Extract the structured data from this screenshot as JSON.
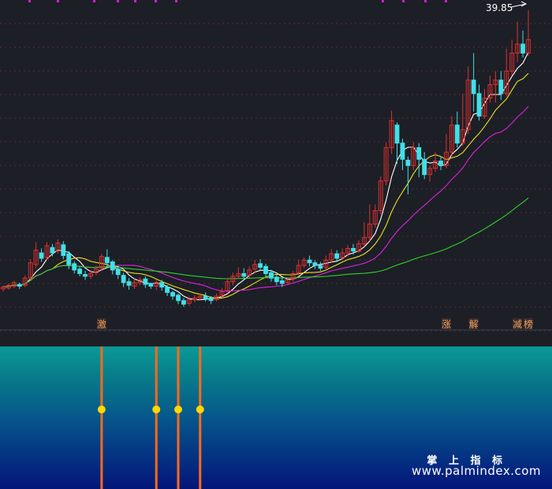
{
  "chart_data": {
    "type": "candlestick",
    "price_label": "39.85",
    "ylim": [
      6,
      41
    ],
    "colors": {
      "background": "#1c1f26",
      "up": "#e03030",
      "down": "#40e0e8",
      "ma_fast": "#ffffff",
      "ma_mid": "#f0e020",
      "ma_slow": "#e020e0",
      "ma_long": "#30d030",
      "grid": "#8a3a3a",
      "signal_line": "#ff6a1a",
      "signal_dot": "#ffd800"
    },
    "candles": [
      [
        8.9,
        9.1,
        8.6,
        9.3
      ],
      [
        9.0,
        9.3,
        8.8,
        9.5
      ],
      [
        9.2,
        9.6,
        9.0,
        9.8
      ],
      [
        9.4,
        9.2,
        8.9,
        9.6
      ],
      [
        9.3,
        10.1,
        9.1,
        10.4
      ],
      [
        10.1,
        11.8,
        9.9,
        12.2
      ],
      [
        11.6,
        13.2,
        11.2,
        14.1
      ],
      [
        12.9,
        12.3,
        11.9,
        13.4
      ],
      [
        12.4,
        13.7,
        12.1,
        14.1
      ],
      [
        13.5,
        12.9,
        12.5,
        13.9
      ],
      [
        13.1,
        14.0,
        12.8,
        14.4
      ],
      [
        13.8,
        12.6,
        12.2,
        14.2
      ],
      [
        12.8,
        11.6,
        11.1,
        13.1
      ],
      [
        11.7,
        11.0,
        10.6,
        12.0
      ],
      [
        11.1,
        10.6,
        10.3,
        11.4
      ],
      [
        10.5,
        10.3,
        9.9,
        10.9
      ],
      [
        10.3,
        10.6,
        10.0,
        11.0
      ],
      [
        10.7,
        11.1,
        10.4,
        11.5
      ],
      [
        11.2,
        12.5,
        10.9,
        12.8
      ],
      [
        12.4,
        11.8,
        11.2,
        13.3
      ],
      [
        11.9,
        11.0,
        10.5,
        12.1
      ],
      [
        11.1,
        10.5,
        10.0,
        11.3
      ],
      [
        10.4,
        9.6,
        9.1,
        10.7
      ],
      [
        9.7,
        9.3,
        8.8,
        10.1
      ],
      [
        9.2,
        9.6,
        8.9,
        10.0
      ],
      [
        9.6,
        9.9,
        9.3,
        10.2
      ],
      [
        10.0,
        9.4,
        9.0,
        10.3
      ],
      [
        9.5,
        9.2,
        8.9,
        9.6
      ],
      [
        9.2,
        9.6,
        8.8,
        9.9
      ],
      [
        9.6,
        9.1,
        8.7,
        9.9
      ],
      [
        9.1,
        8.5,
        8.1,
        9.3
      ],
      [
        8.5,
        8.1,
        7.7,
        8.7
      ],
      [
        8.2,
        7.6,
        7.2,
        8.4
      ],
      [
        7.6,
        7.2,
        6.9,
        7.9
      ],
      [
        7.3,
        7.7,
        7.0,
        8.0
      ],
      [
        7.7,
        7.9,
        7.4,
        8.2
      ],
      [
        7.9,
        8.1,
        7.6,
        8.4
      ],
      [
        8.1,
        7.8,
        7.5,
        8.5
      ],
      [
        7.9,
        7.6,
        7.2,
        8.1
      ],
      [
        7.7,
        8.1,
        7.5,
        8.4
      ],
      [
        8.2,
        8.6,
        7.9,
        9.0
      ],
      [
        8.7,
        9.7,
        8.5,
        10.1
      ],
      [
        9.7,
        10.3,
        9.3,
        10.7
      ],
      [
        10.3,
        10.6,
        10.0,
        11.3
      ],
      [
        10.6,
        10.3,
        9.9,
        11.2
      ],
      [
        10.4,
        11.0,
        10.1,
        11.4
      ],
      [
        11.1,
        11.6,
        10.6,
        12.1
      ],
      [
        11.7,
        11.3,
        10.9,
        12.2
      ],
      [
        11.4,
        10.6,
        10.2,
        11.7
      ],
      [
        10.7,
        10.1,
        9.7,
        11.0
      ],
      [
        10.2,
        9.7,
        9.3,
        10.5
      ],
      [
        9.8,
        9.5,
        9.1,
        10.1
      ],
      [
        9.6,
        9.9,
        9.3,
        10.2
      ],
      [
        10.0,
        10.6,
        9.7,
        10.9
      ],
      [
        10.7,
        11.5,
        10.4,
        12.1
      ],
      [
        11.5,
        12.1,
        11.2,
        12.4
      ],
      [
        12.1,
        11.8,
        11.4,
        12.6
      ],
      [
        11.8,
        11.5,
        11.1,
        12.1
      ],
      [
        11.5,
        11.2,
        10.9,
        11.9
      ],
      [
        11.3,
        12.1,
        11.0,
        12.6
      ],
      [
        12.1,
        12.8,
        11.8,
        13.3
      ],
      [
        12.8,
        12.3,
        11.9,
        13.2
      ],
      [
        12.4,
        12.9,
        12.1,
        13.4
      ],
      [
        12.9,
        13.4,
        12.5,
        13.8
      ],
      [
        13.4,
        13.1,
        12.7,
        13.9
      ],
      [
        13.1,
        13.9,
        12.9,
        14.3
      ],
      [
        13.9,
        14.6,
        13.6,
        16.3
      ],
      [
        14.6,
        16.1,
        14.2,
        18.3
      ],
      [
        16.1,
        17.6,
        15.7,
        18.3
      ],
      [
        17.6,
        20.9,
        17.2,
        21.4
      ],
      [
        20.9,
        24.6,
        20.4,
        25.2
      ],
      [
        24.6,
        27.6,
        23.9,
        28.7
      ],
      [
        27.1,
        25.1,
        22.8,
        27.4
      ],
      [
        25.1,
        23.3,
        22.1,
        25.6
      ],
      [
        23.2,
        22.6,
        19.4,
        23.6
      ],
      [
        22.6,
        24.6,
        22.1,
        25.2
      ],
      [
        24.6,
        23.3,
        21.3,
        25.1
      ],
      [
        23.3,
        21.6,
        21.1,
        24.1
      ],
      [
        21.6,
        22.3,
        20.8,
        22.6
      ],
      [
        22.3,
        23.1,
        21.9,
        24.1
      ],
      [
        23.1,
        22.6,
        22.1,
        23.6
      ],
      [
        22.6,
        24.1,
        22.3,
        26.1
      ],
      [
        24.1,
        27.1,
        23.6,
        28.1
      ],
      [
        27.1,
        25.1,
        24.6,
        28.6
      ],
      [
        25.1,
        26.6,
        24.8,
        30.6
      ],
      [
        26.6,
        32.1,
        26.1,
        33.6
      ],
      [
        32.1,
        30.6,
        28.6,
        35.1
      ],
      [
        30.6,
        28.1,
        27.6,
        31.6
      ],
      [
        28.1,
        30.1,
        27.8,
        31.1
      ],
      [
        30.1,
        31.6,
        29.6,
        32.6
      ],
      [
        31.6,
        32.1,
        29.6,
        33.1
      ],
      [
        32.1,
        30.6,
        29.9,
        33.1
      ],
      [
        30.6,
        33.1,
        30.3,
        35.6
      ],
      [
        33.1,
        35.1,
        32.6,
        36.6
      ],
      [
        35.1,
        36.1,
        34.1,
        38.6
      ],
      [
        36.1,
        35.1,
        34.6,
        37.6
      ],
      [
        35.1,
        36.6,
        34.8,
        39.85
      ]
    ],
    "signal_days": [
      18,
      28,
      32,
      36
    ],
    "markers": [
      {
        "label": "激",
        "day": 18
      },
      {
        "label": "涨",
        "day": 81
      },
      {
        "label": "解",
        "day": 86
      },
      {
        "label": "减",
        "day": 94
      },
      {
        "label": "榜",
        "day": 96
      }
    ]
  },
  "watermark": {
    "name": "掌 上 指 标",
    "url": "www.palmindex.com"
  }
}
